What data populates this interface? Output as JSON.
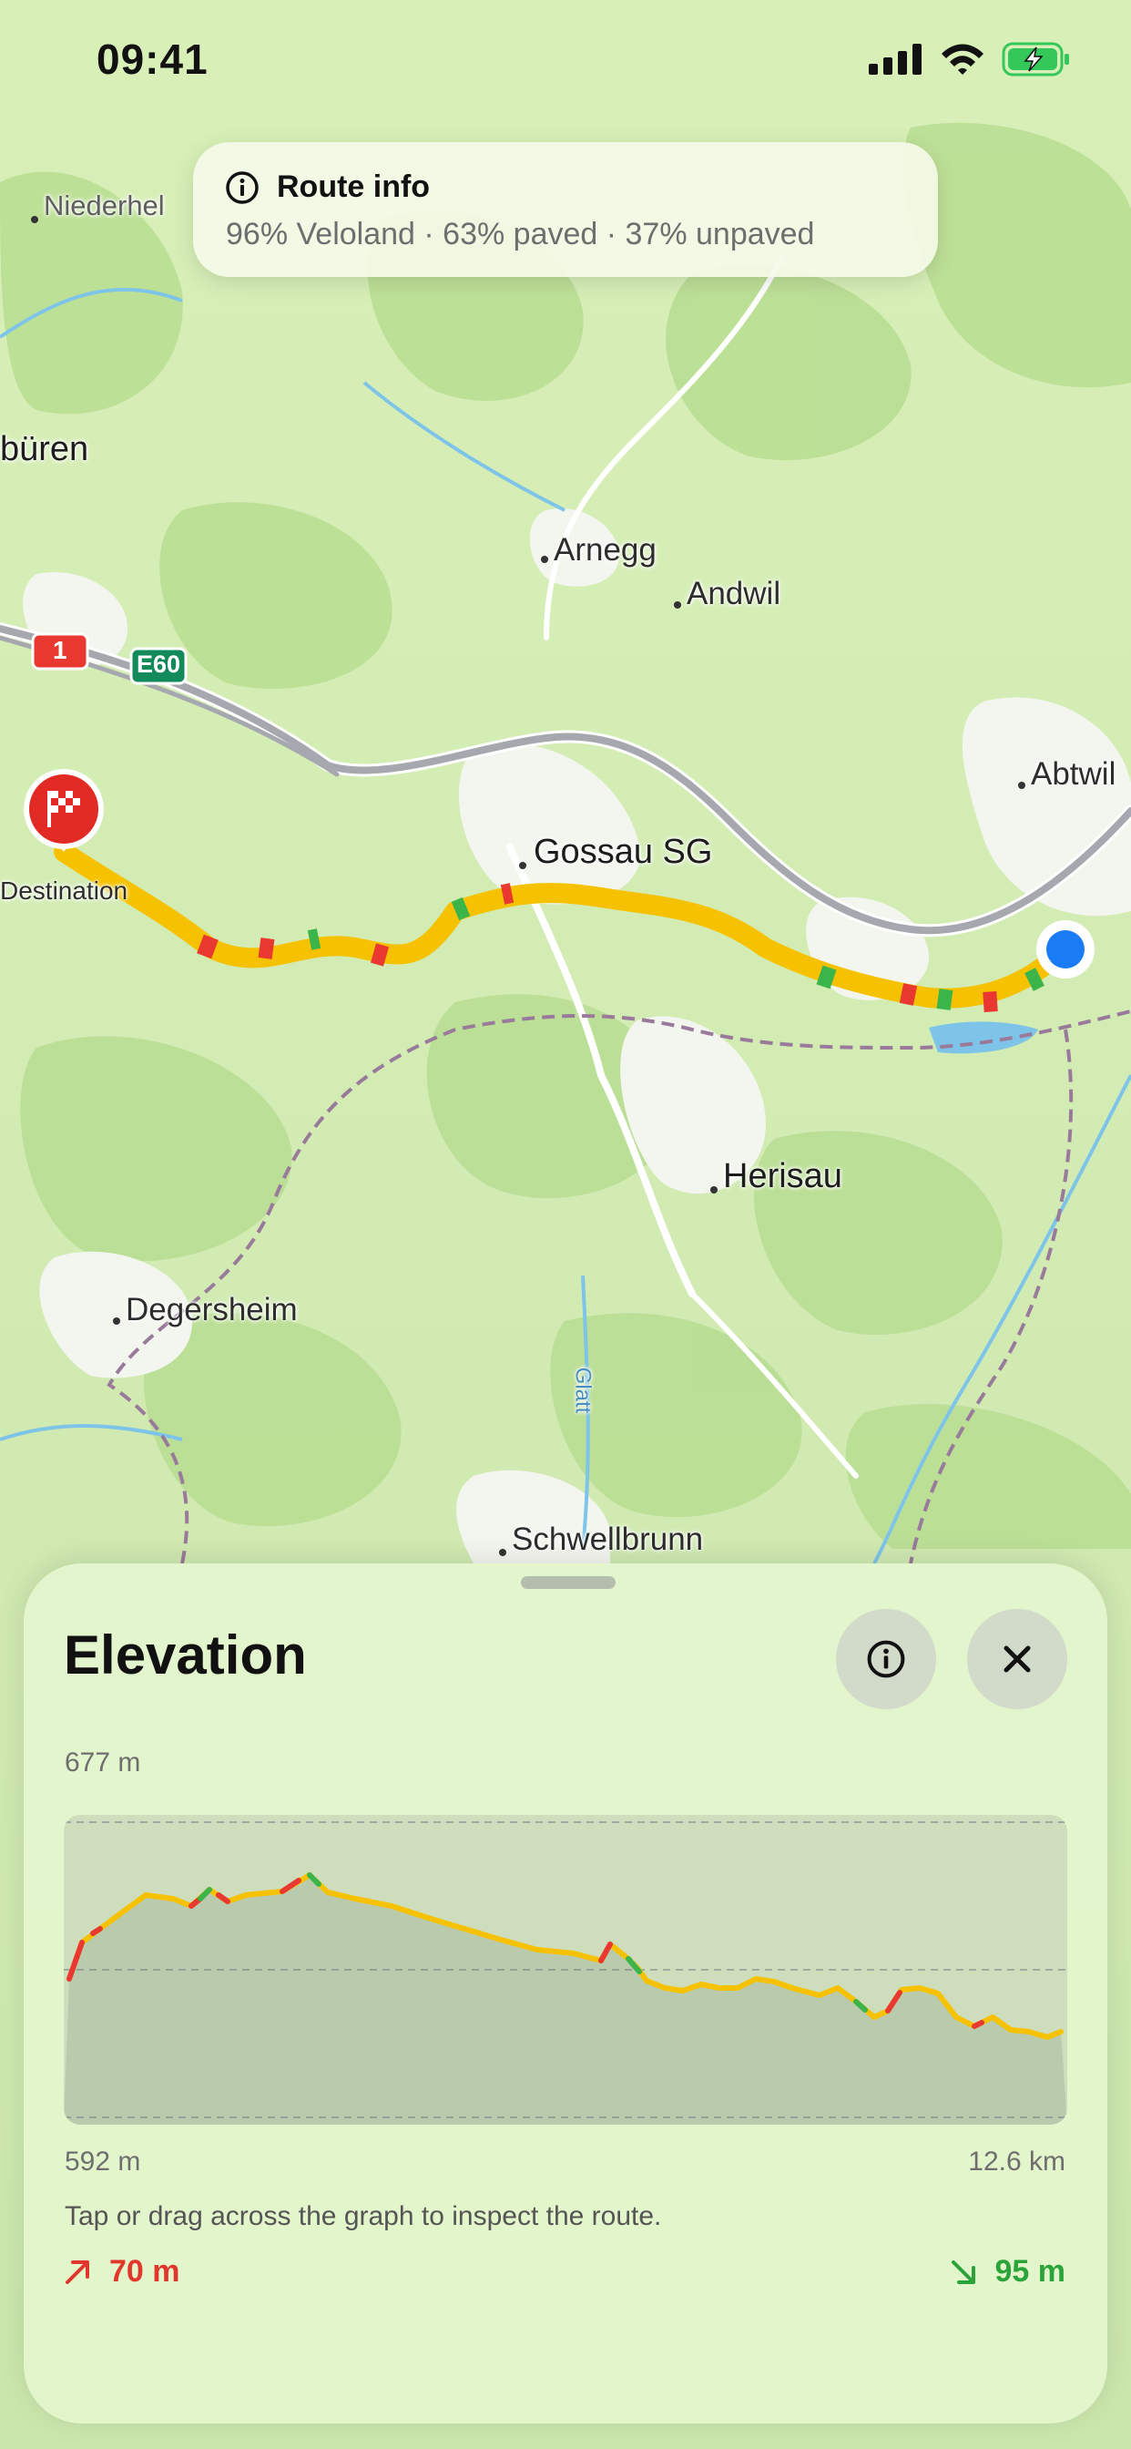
{
  "status_bar": {
    "time": "09:41"
  },
  "route_banner": {
    "title": "Route info",
    "summary": "96% Veloland · 63% paved · 37% unpaved"
  },
  "map": {
    "labels": {
      "niederhel": "Niederhel",
      "bueren": "büren",
      "arnegg": "Arnegg",
      "andwil": "Andwil",
      "abtwil": "Abtwil",
      "gossau": "Gossau SG",
      "herisau": "Herisau",
      "degersheim": "Degersheim",
      "schwellbrunn": "Schwellbrunn",
      "glatt": "Glatt",
      "destination": "Destination"
    },
    "shields": {
      "road_1": "1",
      "road_e60": "E60"
    },
    "colors": {
      "route_main": "#f6c200",
      "route_steep": "#e8382f",
      "route_flat": "#3bb54a",
      "current_location": "#1a7cf5"
    }
  },
  "elevation_sheet": {
    "title": "Elevation",
    "max_label": "677 m",
    "min_label": "592 m",
    "distance_label": "12.6 km",
    "hint": "Tap or drag across the graph to inspect the route.",
    "ascent": "70 m",
    "descent": "95 m",
    "info_icon": "info-icon",
    "close_icon": "close-icon"
  }
}
